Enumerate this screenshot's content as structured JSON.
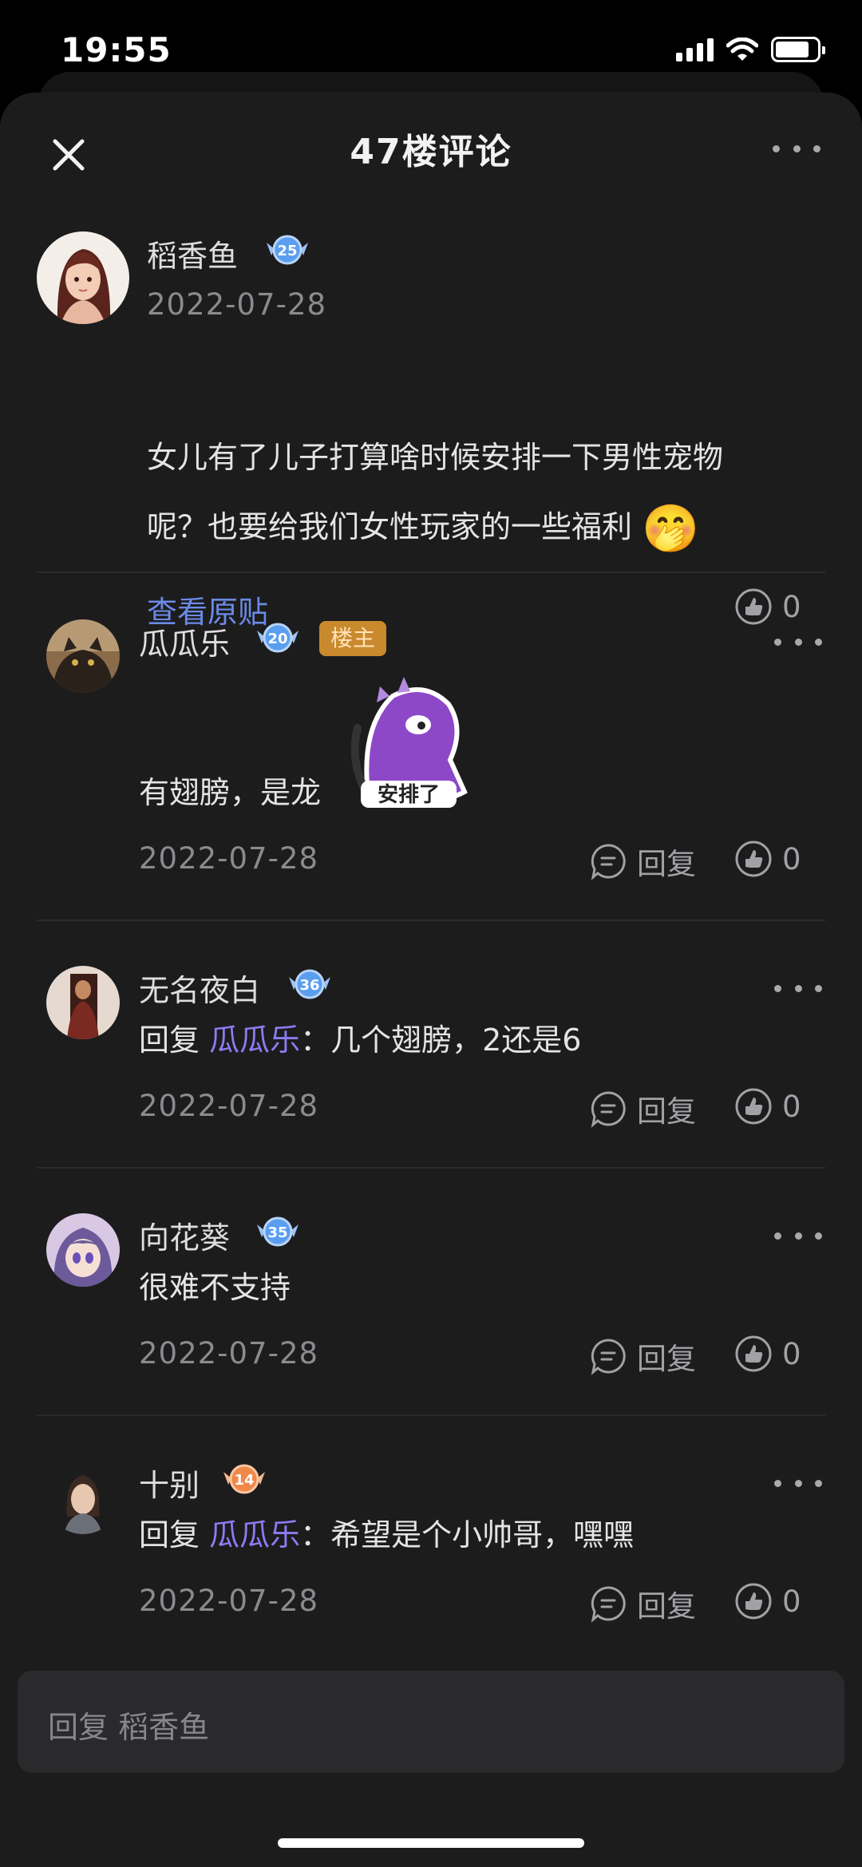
{
  "status_bar": {
    "time": "19:55"
  },
  "header": {
    "title": "47楼评论"
  },
  "post": {
    "author": "稻香鱼",
    "level": "25",
    "date": "2022-07-28",
    "text_line1": "女儿有了儿子打算啥时候安排一下男性宠物",
    "text_line2": "呢？也要给我们女性玩家的一些福利",
    "emoji": "🤭",
    "view_original": "查看原贴",
    "likes": "0"
  },
  "comments": [
    {
      "author": "瓜瓜乐",
      "level": "20",
      "badge": "楼主",
      "text": "有翅膀，是龙",
      "sticker_text": "安排了",
      "date": "2022-07-28",
      "reply_label": "回复",
      "likes": "0"
    },
    {
      "author": "无名夜白",
      "level": "36",
      "reply_prefix": "回复 ",
      "reply_target": "瓜瓜乐",
      "text": "：几个翅膀，2还是6",
      "date": "2022-07-28",
      "reply_label": "回复",
      "likes": "0"
    },
    {
      "author": "向花葵",
      "level": "35",
      "text": "很难不支持",
      "date": "2022-07-28",
      "reply_label": "回复",
      "likes": "0"
    },
    {
      "author": "十别",
      "level": "14",
      "reply_prefix": "回复 ",
      "reply_target": "瓜瓜乐",
      "text": "：希望是个小帅哥，嘿嘿",
      "date": "2022-07-28",
      "reply_label": "回复",
      "likes": "0"
    }
  ],
  "reply_input": {
    "placeholder": "回复 稻香鱼"
  },
  "colors": {
    "background": "#1c1c1d",
    "level_blue": "#5b9ef0",
    "level_orange": "#f0884a",
    "host_badge": "#c98a2e",
    "link": "#6b8ae6",
    "mention": "#8b7cf2"
  },
  "icons": [
    "close-icon",
    "more-icon",
    "level-badge-icon",
    "thumbs-up-icon",
    "reply-bubble-icon",
    "signal-icon",
    "wifi-icon",
    "battery-icon"
  ]
}
